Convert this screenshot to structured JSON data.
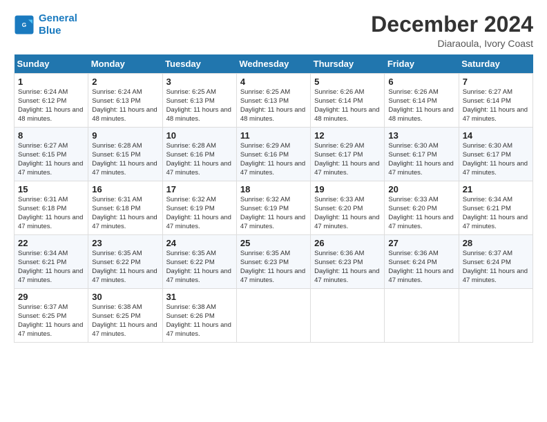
{
  "logo": {
    "line1": "General",
    "line2": "Blue"
  },
  "title": "December 2024",
  "location": "Diaraoula, Ivory Coast",
  "days_of_week": [
    "Sunday",
    "Monday",
    "Tuesday",
    "Wednesday",
    "Thursday",
    "Friday",
    "Saturday"
  ],
  "weeks": [
    [
      {
        "day": "1",
        "sunrise": "6:24 AM",
        "sunset": "6:12 PM",
        "daylight": "11 hours and 48 minutes."
      },
      {
        "day": "2",
        "sunrise": "6:24 AM",
        "sunset": "6:13 PM",
        "daylight": "11 hours and 48 minutes."
      },
      {
        "day": "3",
        "sunrise": "6:25 AM",
        "sunset": "6:13 PM",
        "daylight": "11 hours and 48 minutes."
      },
      {
        "day": "4",
        "sunrise": "6:25 AM",
        "sunset": "6:13 PM",
        "daylight": "11 hours and 48 minutes."
      },
      {
        "day": "5",
        "sunrise": "6:26 AM",
        "sunset": "6:14 PM",
        "daylight": "11 hours and 48 minutes."
      },
      {
        "day": "6",
        "sunrise": "6:26 AM",
        "sunset": "6:14 PM",
        "daylight": "11 hours and 48 minutes."
      },
      {
        "day": "7",
        "sunrise": "6:27 AM",
        "sunset": "6:14 PM",
        "daylight": "11 hours and 47 minutes."
      }
    ],
    [
      {
        "day": "8",
        "sunrise": "6:27 AM",
        "sunset": "6:15 PM",
        "daylight": "11 hours and 47 minutes."
      },
      {
        "day": "9",
        "sunrise": "6:28 AM",
        "sunset": "6:15 PM",
        "daylight": "11 hours and 47 minutes."
      },
      {
        "day": "10",
        "sunrise": "6:28 AM",
        "sunset": "6:16 PM",
        "daylight": "11 hours and 47 minutes."
      },
      {
        "day": "11",
        "sunrise": "6:29 AM",
        "sunset": "6:16 PM",
        "daylight": "11 hours and 47 minutes."
      },
      {
        "day": "12",
        "sunrise": "6:29 AM",
        "sunset": "6:17 PM",
        "daylight": "11 hours and 47 minutes."
      },
      {
        "day": "13",
        "sunrise": "6:30 AM",
        "sunset": "6:17 PM",
        "daylight": "11 hours and 47 minutes."
      },
      {
        "day": "14",
        "sunrise": "6:30 AM",
        "sunset": "6:17 PM",
        "daylight": "11 hours and 47 minutes."
      }
    ],
    [
      {
        "day": "15",
        "sunrise": "6:31 AM",
        "sunset": "6:18 PM",
        "daylight": "11 hours and 47 minutes."
      },
      {
        "day": "16",
        "sunrise": "6:31 AM",
        "sunset": "6:18 PM",
        "daylight": "11 hours and 47 minutes."
      },
      {
        "day": "17",
        "sunrise": "6:32 AM",
        "sunset": "6:19 PM",
        "daylight": "11 hours and 47 minutes."
      },
      {
        "day": "18",
        "sunrise": "6:32 AM",
        "sunset": "6:19 PM",
        "daylight": "11 hours and 47 minutes."
      },
      {
        "day": "19",
        "sunrise": "6:33 AM",
        "sunset": "6:20 PM",
        "daylight": "11 hours and 47 minutes."
      },
      {
        "day": "20",
        "sunrise": "6:33 AM",
        "sunset": "6:20 PM",
        "daylight": "11 hours and 47 minutes."
      },
      {
        "day": "21",
        "sunrise": "6:34 AM",
        "sunset": "6:21 PM",
        "daylight": "11 hours and 47 minutes."
      }
    ],
    [
      {
        "day": "22",
        "sunrise": "6:34 AM",
        "sunset": "6:21 PM",
        "daylight": "11 hours and 47 minutes."
      },
      {
        "day": "23",
        "sunrise": "6:35 AM",
        "sunset": "6:22 PM",
        "daylight": "11 hours and 47 minutes."
      },
      {
        "day": "24",
        "sunrise": "6:35 AM",
        "sunset": "6:22 PM",
        "daylight": "11 hours and 47 minutes."
      },
      {
        "day": "25",
        "sunrise": "6:35 AM",
        "sunset": "6:23 PM",
        "daylight": "11 hours and 47 minutes."
      },
      {
        "day": "26",
        "sunrise": "6:36 AM",
        "sunset": "6:23 PM",
        "daylight": "11 hours and 47 minutes."
      },
      {
        "day": "27",
        "sunrise": "6:36 AM",
        "sunset": "6:24 PM",
        "daylight": "11 hours and 47 minutes."
      },
      {
        "day": "28",
        "sunrise": "6:37 AM",
        "sunset": "6:24 PM",
        "daylight": "11 hours and 47 minutes."
      }
    ],
    [
      {
        "day": "29",
        "sunrise": "6:37 AM",
        "sunset": "6:25 PM",
        "daylight": "11 hours and 47 minutes."
      },
      {
        "day": "30",
        "sunrise": "6:38 AM",
        "sunset": "6:25 PM",
        "daylight": "11 hours and 47 minutes."
      },
      {
        "day": "31",
        "sunrise": "6:38 AM",
        "sunset": "6:26 PM",
        "daylight": "11 hours and 47 minutes."
      },
      null,
      null,
      null,
      null
    ]
  ]
}
